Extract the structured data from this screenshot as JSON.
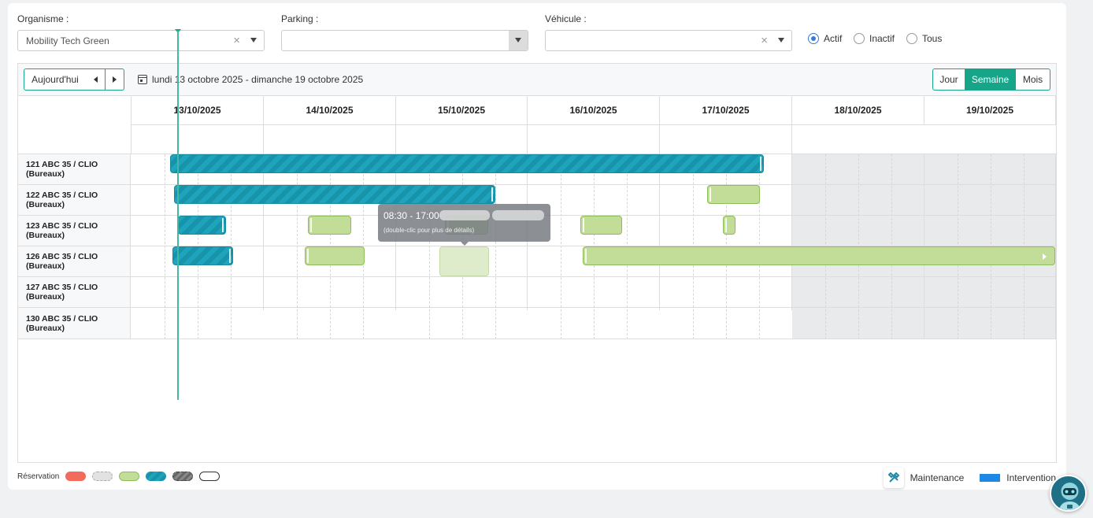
{
  "filters": {
    "organisme": {
      "label": "Organisme :",
      "value": "Mobility Tech Green"
    },
    "parking": {
      "label": "Parking :",
      "value": ""
    },
    "vehicule": {
      "label": "Véhicule :",
      "value": ""
    },
    "status_options": [
      {
        "label": "Actif",
        "selected": true
      },
      {
        "label": "Inactif",
        "selected": false
      },
      {
        "label": "Tous",
        "selected": false
      }
    ]
  },
  "toolbar": {
    "today_label": "Aujourd'hui",
    "date_range": "lundi 13 octobre 2025 - dimanche 19 octobre 2025",
    "views": [
      {
        "label": "Jour",
        "active": false
      },
      {
        "label": "Semaine",
        "active": true
      },
      {
        "label": "Mois",
        "active": false
      }
    ]
  },
  "days": [
    "13/10/2025",
    "14/10/2025",
    "15/10/2025",
    "16/10/2025",
    "17/10/2025",
    "18/10/2025",
    "19/10/2025"
  ],
  "vehicles": [
    "121 ABC 35 / CLIO (Bureaux)",
    "122 ABC 35 / CLIO (Bureaux)",
    "123 ABC 35 / CLIO (Bureaux)",
    "126 ABC 35 / CLIO (Bureaux)",
    "127 ABC 35 / CLIO (Bureaux)",
    "130 ABC 35 / CLIO (Bureaux)"
  ],
  "tooltip": {
    "time": "08:30 - 17:00",
    "hint": "(double-clic pour plus de détails)"
  },
  "legend": {
    "reservation_label": "Réservation",
    "reservation_colors": [
      "#f26b5b",
      "#e2e2e2",
      "#c2dd98",
      "#1ea5bd",
      "#777777",
      "#ffffff"
    ],
    "maintenance_label": "Maintenance",
    "intervention_label": "Intervention",
    "intervention_color": "#1e88e5"
  },
  "colors": {
    "accent": "#17a589",
    "blue_bar": "#1ea5bd",
    "green_bar": "#c2dd98"
  }
}
